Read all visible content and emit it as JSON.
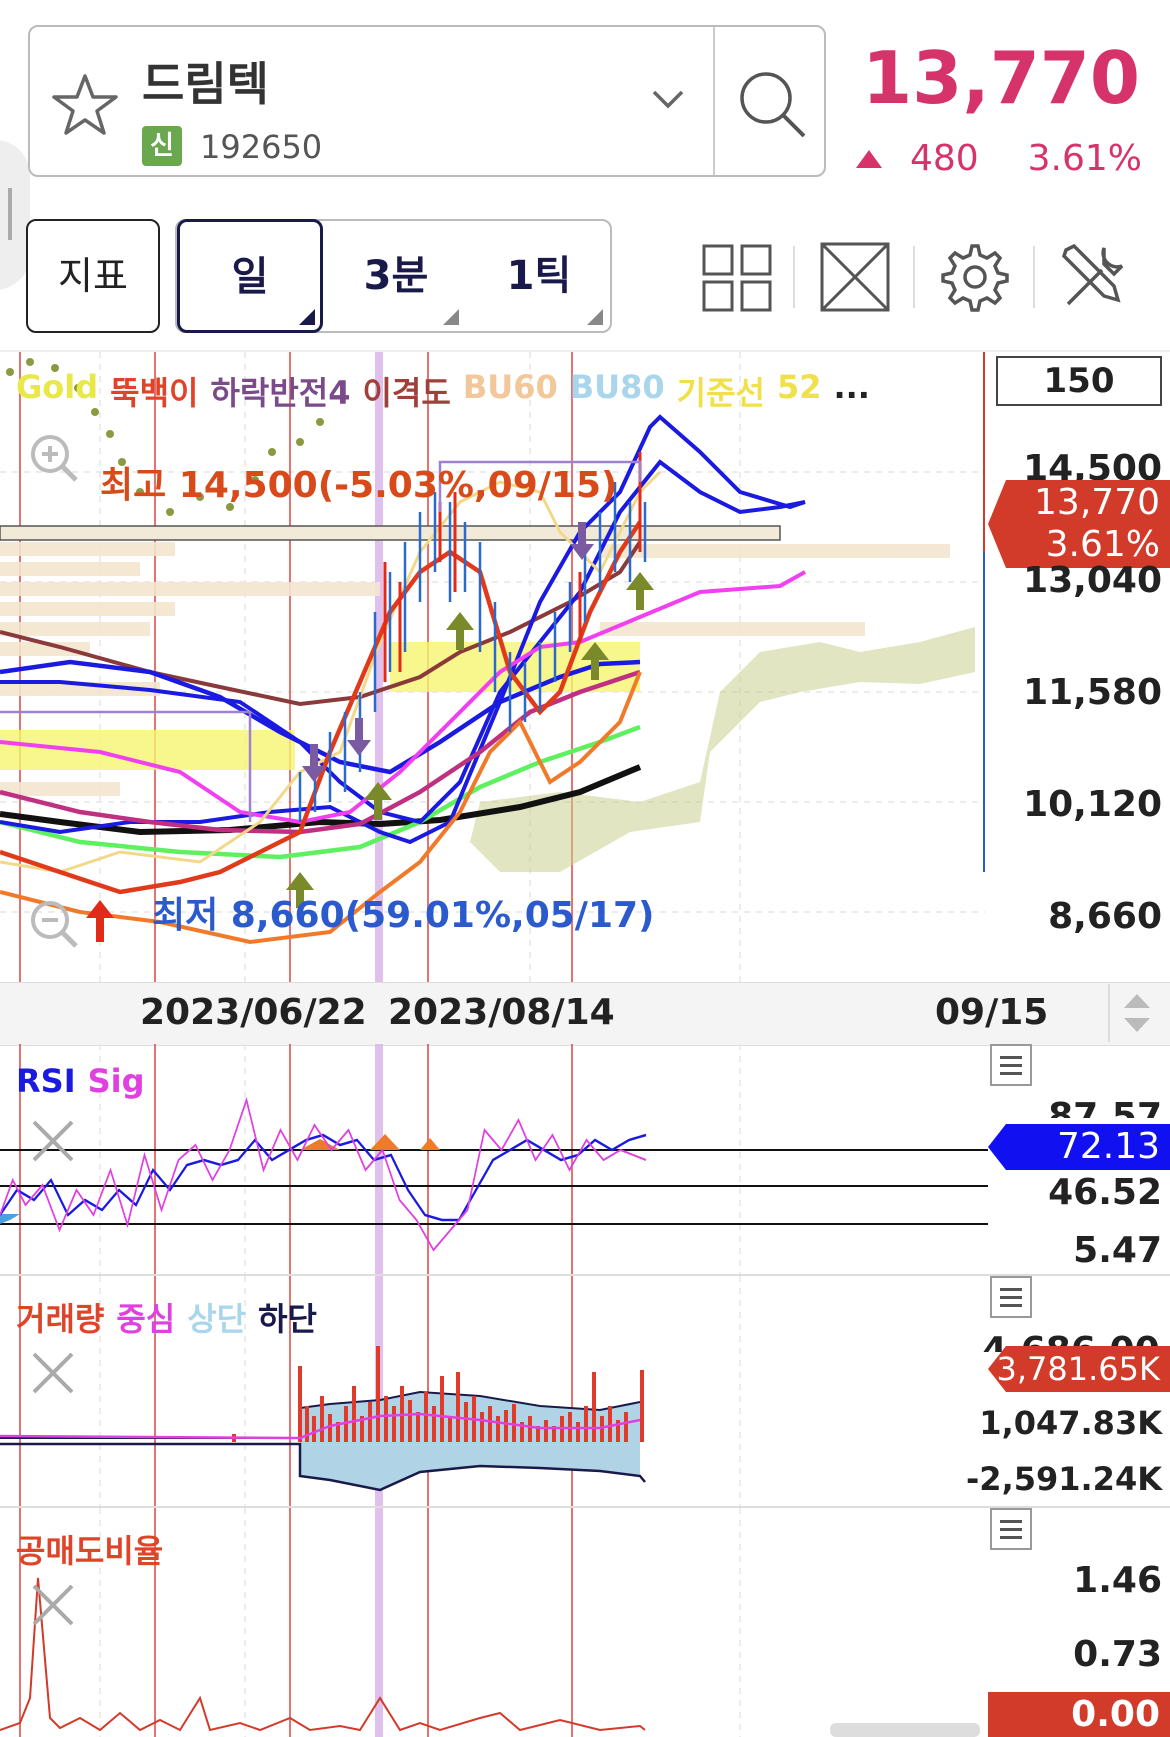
{
  "header": {
    "stock_name": "드림텍",
    "badge": "신",
    "stock_code": "192650",
    "price": "13,770",
    "change": "480",
    "change_pct": "3.61%"
  },
  "toolbar": {
    "indicator_label": "지표",
    "tabs": [
      "일",
      "3분",
      "1틱"
    ]
  },
  "main_chart": {
    "legend": [
      {
        "text": "Gold",
        "color": "#e8e84a"
      },
      {
        "text": "뚝백이",
        "color": "#e04428"
      },
      {
        "text": "하락반전4",
        "color": "#7a4a8a"
      },
      {
        "text": "이격도",
        "color": "#a0403a"
      },
      {
        "text": "BU60",
        "color": "#f2c79a"
      },
      {
        "text": "BU80",
        "color": "#a9d6ec"
      },
      {
        "text": "기준선",
        "color": "#f0e04a"
      },
      {
        "text": "52",
        "color": "#f0e04a"
      },
      {
        "text": "...",
        "color": "#222222"
      }
    ],
    "period_box": "150",
    "high_label": "최고 14,500(-5.03%,09/15)",
    "low_label": "최저 8,660(59.01%,05/17)",
    "y_axis": [
      "14,500",
      "13,040",
      "11,580",
      "10,120",
      "8,660"
    ],
    "current_price": "13,770",
    "current_pct": "3.61%",
    "x_axis": [
      "2023/06/22",
      "2023/08/14",
      "09/15"
    ]
  },
  "rsi_panel": {
    "legend": [
      {
        "text": "RSI",
        "color": "#1a1ae0"
      },
      {
        "text": "Sig",
        "color": "#e040e0"
      }
    ],
    "axis": [
      "87.57",
      "46.52",
      "5.47"
    ],
    "current": "72.13"
  },
  "volume_panel": {
    "legend": [
      {
        "text": "거래량",
        "color": "#e04428"
      },
      {
        "text": "중심",
        "color": "#e040e0"
      },
      {
        "text": "상단",
        "color": "#a9d6ec"
      },
      {
        "text": "하단",
        "color": "#1a1a4a"
      }
    ],
    "axis_top_partial": "4,686.00K",
    "current": "3,781.65K",
    "axis": [
      "1,047.83K",
      "-2,591.24K"
    ]
  },
  "short_panel": {
    "legend": [
      {
        "text": "공매도비율",
        "color": "#e04428"
      }
    ],
    "axis": [
      "1.46",
      "0.73"
    ],
    "current": "0.00"
  },
  "colors": {
    "up": "#d7336b",
    "accent": "#1a1a4a",
    "price_tag": "#d23a2a",
    "rsi_tag": "#1010f0"
  }
}
